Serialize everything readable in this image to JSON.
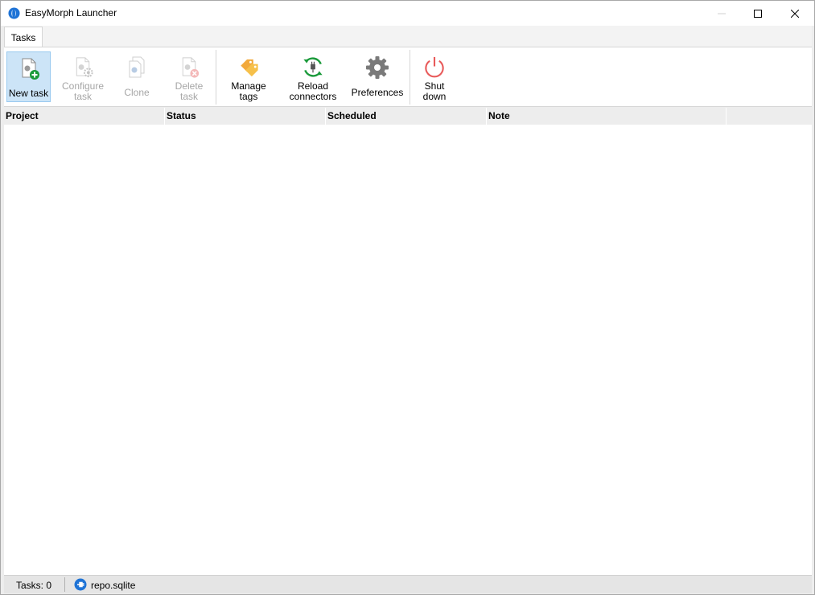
{
  "window": {
    "title": "EasyMorph Launcher"
  },
  "tabs": [
    {
      "label": "Tasks"
    }
  ],
  "ribbon": {
    "new_task": "New task",
    "configure_task": "Configure\ntask",
    "clone": "Clone",
    "delete_task": "Delete\ntask",
    "manage_tags": "Manage\ntags",
    "reload_connectors": "Reload\nconnectors",
    "preferences": "Preferences",
    "shut_down": "Shut\ndown"
  },
  "table": {
    "columns": [
      "Project",
      "Status",
      "Scheduled",
      "Note"
    ],
    "rows": []
  },
  "statusbar": {
    "task_count": "Tasks: 0",
    "repository": "repo.sqlite"
  },
  "icons": {
    "app": "easymorph-logo-icon",
    "new_task": "document-plus-icon",
    "configure_task": "document-gear-icon",
    "clone": "documents-copy-icon",
    "delete_task": "document-delete-icon",
    "manage_tags": "tags-icon",
    "reload_connectors": "plug-refresh-icon",
    "preferences": "gear-icon",
    "shut_down": "power-icon",
    "repository": "database-plug-icon"
  },
  "colors": {
    "accent_blue": "#1e73d6",
    "add_green": "#1a9a3a",
    "tag_orange": "#f2a93b",
    "power_red": "#e85a5a",
    "selected_bg": "#cce4f7"
  }
}
